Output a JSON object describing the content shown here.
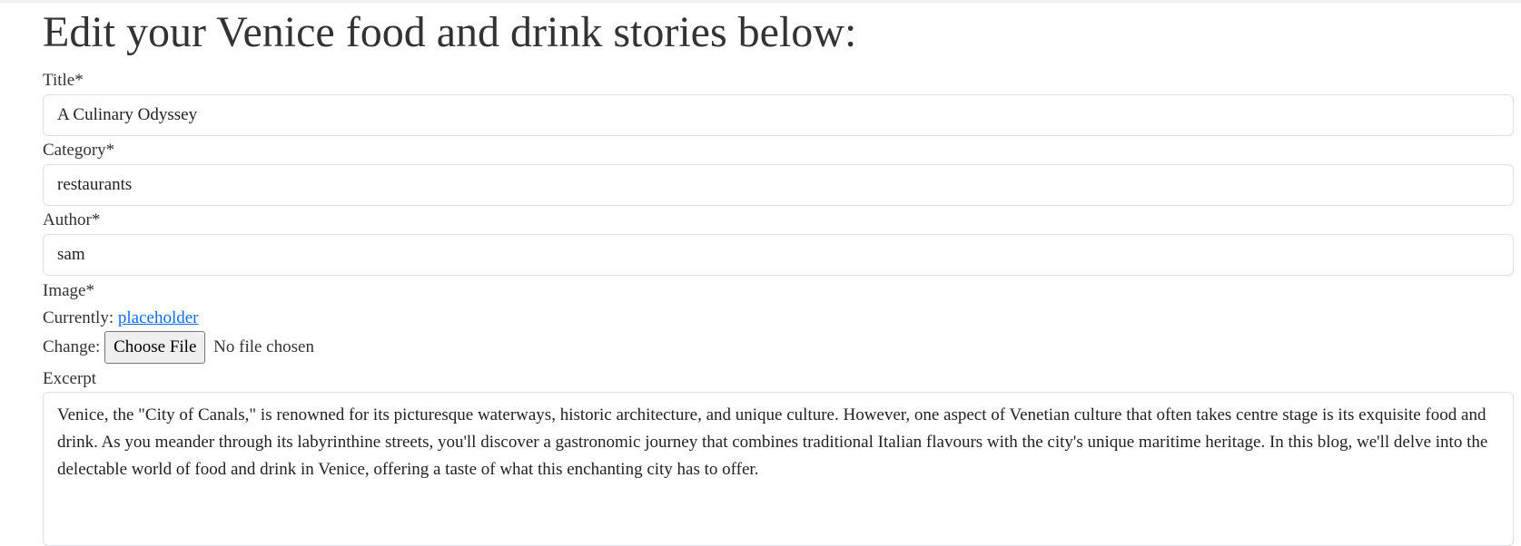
{
  "page": {
    "heading": "Edit your Venice food and drink stories below:"
  },
  "form": {
    "title": {
      "label": "Title*",
      "value": "A Culinary Odyssey"
    },
    "category": {
      "label": "Category*",
      "value": "restaurants"
    },
    "author": {
      "label": "Author*",
      "value": "sam"
    },
    "image": {
      "label": "Image*",
      "currently_label": "Currently:",
      "current_file": "placeholder",
      "change_label": "Change:",
      "choose_button": "Choose File",
      "file_status": "No file chosen"
    },
    "excerpt": {
      "label": "Excerpt",
      "value": "Venice, the \"City of Canals,\" is renowned for its picturesque waterways, historic architecture, and unique culture. However, one aspect of Venetian culture that often takes centre stage is its exquisite food and drink. As you meander through its labyrinthine streets, you'll discover a gastronomic journey that combines traditional Italian flavours with the city's unique maritime heritage. In this blog, we'll delve into the delectable world of food and drink in Venice, offering a taste of what this enchanting city has to offer."
    }
  },
  "colors": {
    "text": "#333333",
    "link": "#0d6efd",
    "input_border": "#dcdfe3",
    "button_bg": "#efefef"
  }
}
